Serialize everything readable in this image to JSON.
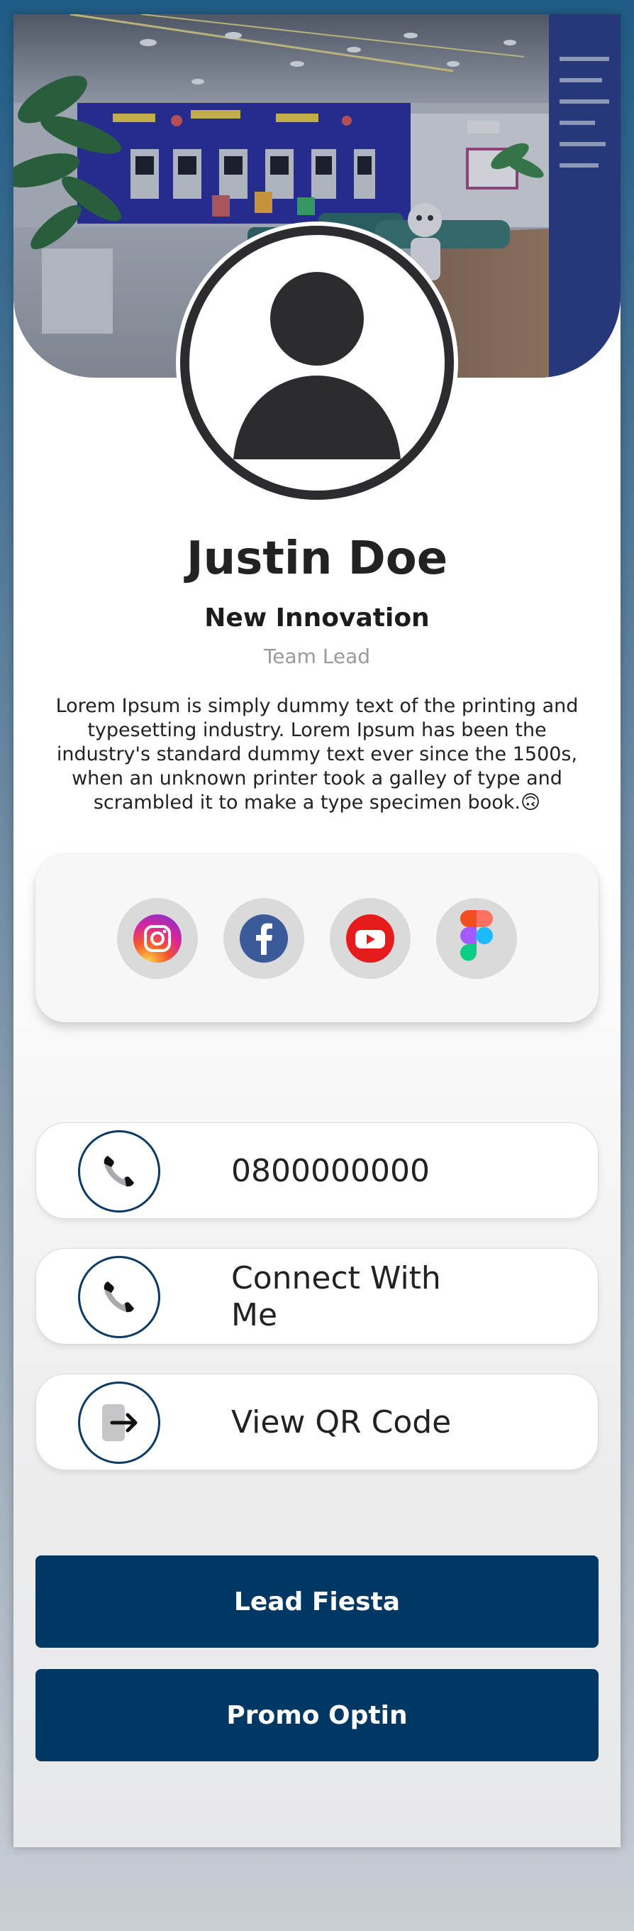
{
  "profile": {
    "name": "Justin Doe",
    "company": "New Innovation",
    "role": "Team Lead",
    "bio": "Lorem Ipsum is simply dummy text of the printing and typesetting industry. Lorem Ipsum has been the industry's standard dummy text ever since the 1500s, when an unknown printer took a galley of type and scrambled it to make a type specimen book.",
    "bio_emoji": "🙃"
  },
  "social": [
    {
      "name": "Instagram",
      "icon": "instagram-icon"
    },
    {
      "name": "Facebook",
      "icon": "facebook-icon"
    },
    {
      "name": "YouTube",
      "icon": "youtube-icon"
    },
    {
      "name": "Figma",
      "icon": "figma-icon"
    }
  ],
  "contacts": [
    {
      "label": "0800000000",
      "icon": "phone-icon"
    },
    {
      "label": "Connect With Me",
      "icon": "phone-icon"
    },
    {
      "label": "View QR Code",
      "icon": "exit-arrow-icon"
    }
  ],
  "buttons": {
    "primary": "Lead Fiesta",
    "secondary": "Promo Optin"
  },
  "colors": {
    "brand_navy": "#003763",
    "icon_ring": "#0c3a63",
    "avatar_dark": "#2c2c30"
  }
}
